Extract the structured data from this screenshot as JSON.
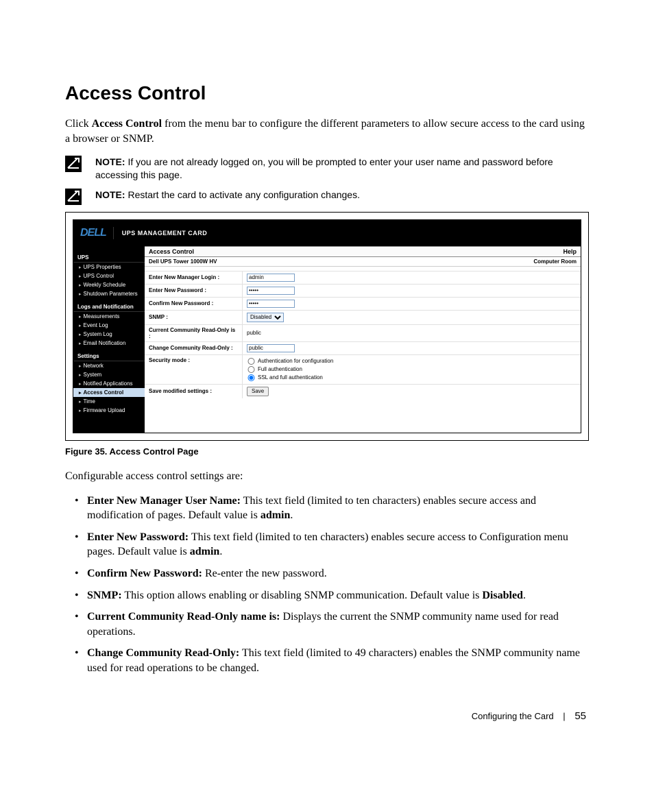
{
  "heading": "Access Control",
  "intro_pre": "Click ",
  "intro_bold": "Access Control",
  "intro_post": " from the menu bar to configure the different parameters to allow secure access to the card using a browser or SNMP.",
  "note1_label": "NOTE:",
  "note1_text": " If you are not already logged on, you will be prompted to enter your user name and password before accessing this page.",
  "note2_label": "NOTE:",
  "note2_text": " Restart the card to activate any configuration changes.",
  "figcap": "Figure 35. Access Control Page",
  "shot": {
    "header_title": "UPS MANAGEMENT CARD",
    "logo": "DELL",
    "sidebar": {
      "s1": "UPS",
      "i1": "UPS Properties",
      "i2": "UPS Control",
      "i3": "Weekly Schedule",
      "i4": "Shutdown Parameters",
      "s2": "Logs and Notification",
      "i5": "Measurements",
      "i6": "Event Log",
      "i7": "System Log",
      "i8": "Email Notification",
      "s3": "Settings",
      "i9": "Network",
      "i10": "System",
      "i11": "Notified Applications",
      "i12": "Access Control",
      "i13": "Time",
      "i14": "Firmware Upload"
    },
    "content": {
      "title": "Access Control",
      "help": "Help",
      "device": "Dell UPS Tower 1000W HV",
      "location": "Computer Room",
      "rows": {
        "r1l": "Enter New Manager Login :",
        "r1v": "admin",
        "r2l": "Enter New Password :",
        "r2v": "•••••",
        "r3l": "Confirm New Password :",
        "r3v": "•••••",
        "r4l": "SNMP :",
        "r4v": "Disabled",
        "r5l": "Current Community Read-Only is :",
        "r5v": "public",
        "r6l": "Change Community Read-Only :",
        "r6v": "public",
        "r7l": "Security mode :",
        "r7a": "Authentication for configuration",
        "r7b": "Full authentication",
        "r7c": "SSL and full authentication",
        "r8l": "Save modified settings :",
        "r8btn": "Save"
      }
    }
  },
  "lead2": "Configurable access control settings are:",
  "bullets": [
    {
      "b": "Enter New Manager User Name:",
      "t": " This text field (limited to ten characters) enables secure access and modification of pages. Default value is ",
      "b2": "admin",
      "t2": "."
    },
    {
      "b": "Enter New Password:",
      "t": " This text field (limited to ten characters) enables secure access to Configuration menu pages. Default value is ",
      "b2": "admin",
      "t2": "."
    },
    {
      "b": "Confirm New Password:",
      "t": " Re-enter the new password."
    },
    {
      "b": "SNMP:",
      "t": " This option allows enabling or disabling SNMP communication. Default value is ",
      "b2": "Disabled",
      "t2": "."
    },
    {
      "b": "Current Community Read-Only name is:",
      "t": " Displays the current the SNMP community name used for read operations."
    },
    {
      "b": "Change Community Read-Only:",
      "t": " This text field (limited to 49 characters) enables the SNMP community name used for read operations to be changed."
    }
  ],
  "footer_section": "Configuring the Card",
  "footer_page": "55"
}
